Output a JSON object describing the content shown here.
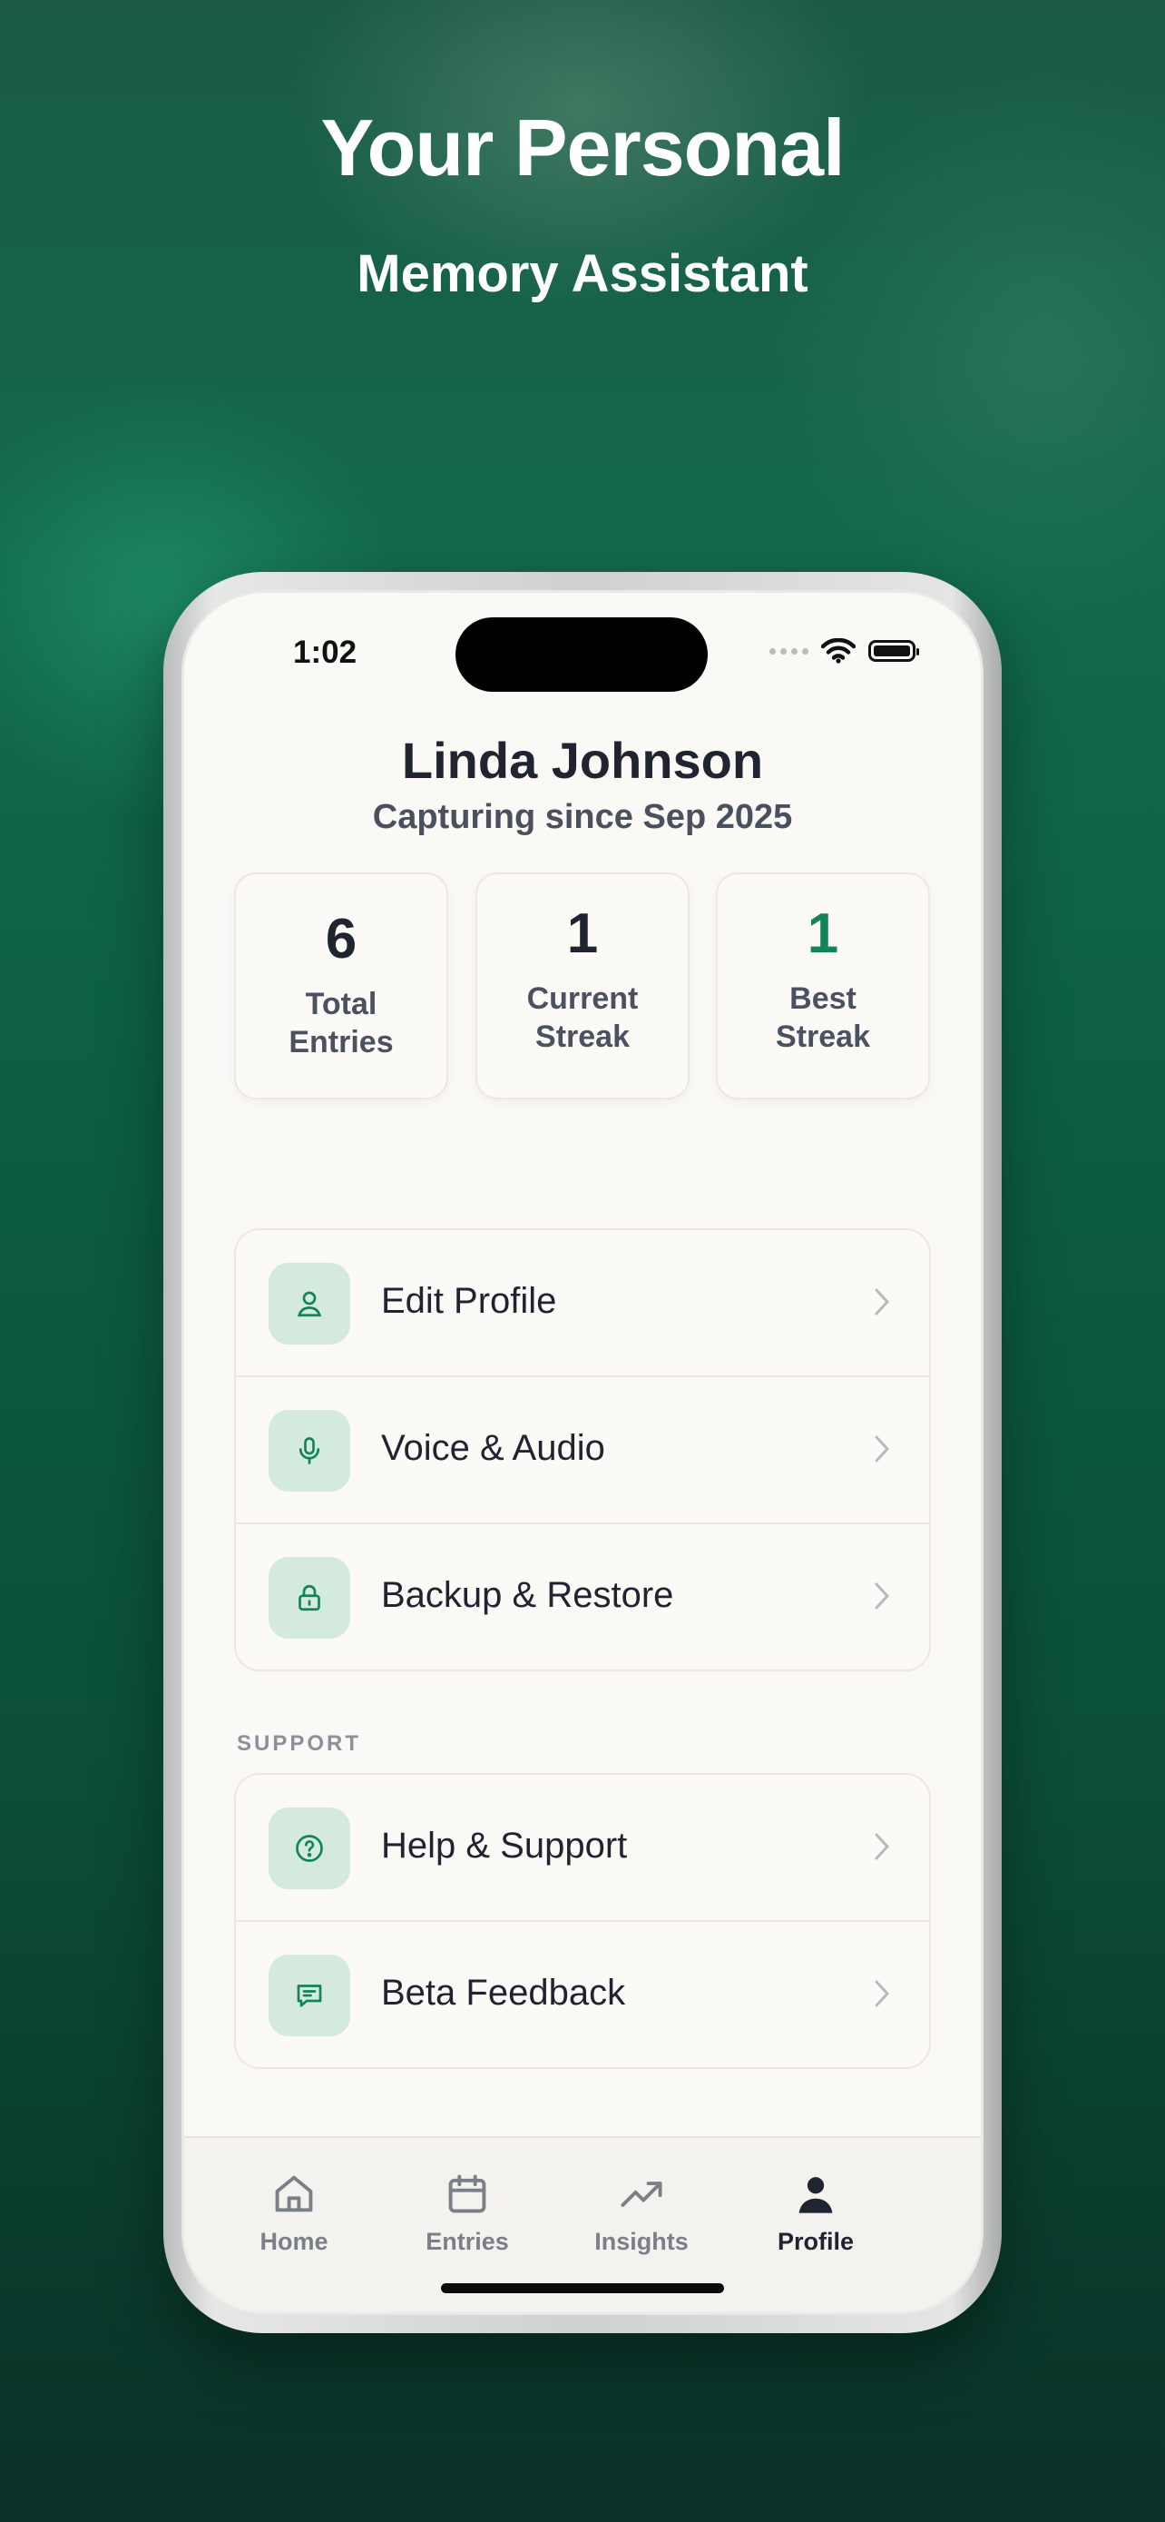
{
  "marketing": {
    "title": "Your Personal",
    "subtitle": "Memory Assistant"
  },
  "status_bar": {
    "time": "1:02",
    "icons": [
      "signal-dots-icon",
      "wifi-icon",
      "battery-icon"
    ]
  },
  "profile": {
    "name": "Linda Johnson",
    "since": "Capturing since Sep 2025"
  },
  "stats": [
    {
      "value": "6",
      "label_line1": "Total",
      "label_line2": "Entries"
    },
    {
      "value": "1",
      "label_line1": "Current",
      "label_line2": "Streak"
    },
    {
      "value": "1",
      "label_line1": "Best",
      "label_line2": "Streak"
    }
  ],
  "settings": {
    "items": [
      {
        "label": "Edit Profile",
        "icon": "user-icon"
      },
      {
        "label": "Voice & Audio",
        "icon": "microphone-icon"
      },
      {
        "label": "Backup & Restore",
        "icon": "lock-icon"
      }
    ]
  },
  "support": {
    "section_label": "SUPPORT",
    "items": [
      {
        "label": "Help & Support",
        "icon": "help-circle-icon"
      },
      {
        "label": "Beta Feedback",
        "icon": "message-icon"
      }
    ]
  },
  "tabbar": {
    "tabs": [
      {
        "label": "Home",
        "icon": "home-icon",
        "active": false
      },
      {
        "label": "Entries",
        "icon": "calendar-icon",
        "active": false
      },
      {
        "label": "Insights",
        "icon": "trending-up-icon",
        "active": false
      },
      {
        "label": "Profile",
        "icon": "profile-icon",
        "active": true
      }
    ]
  },
  "colors": {
    "accent": "#12845a",
    "icon_bg": "#d5eadf",
    "background": "#0c5e41"
  }
}
